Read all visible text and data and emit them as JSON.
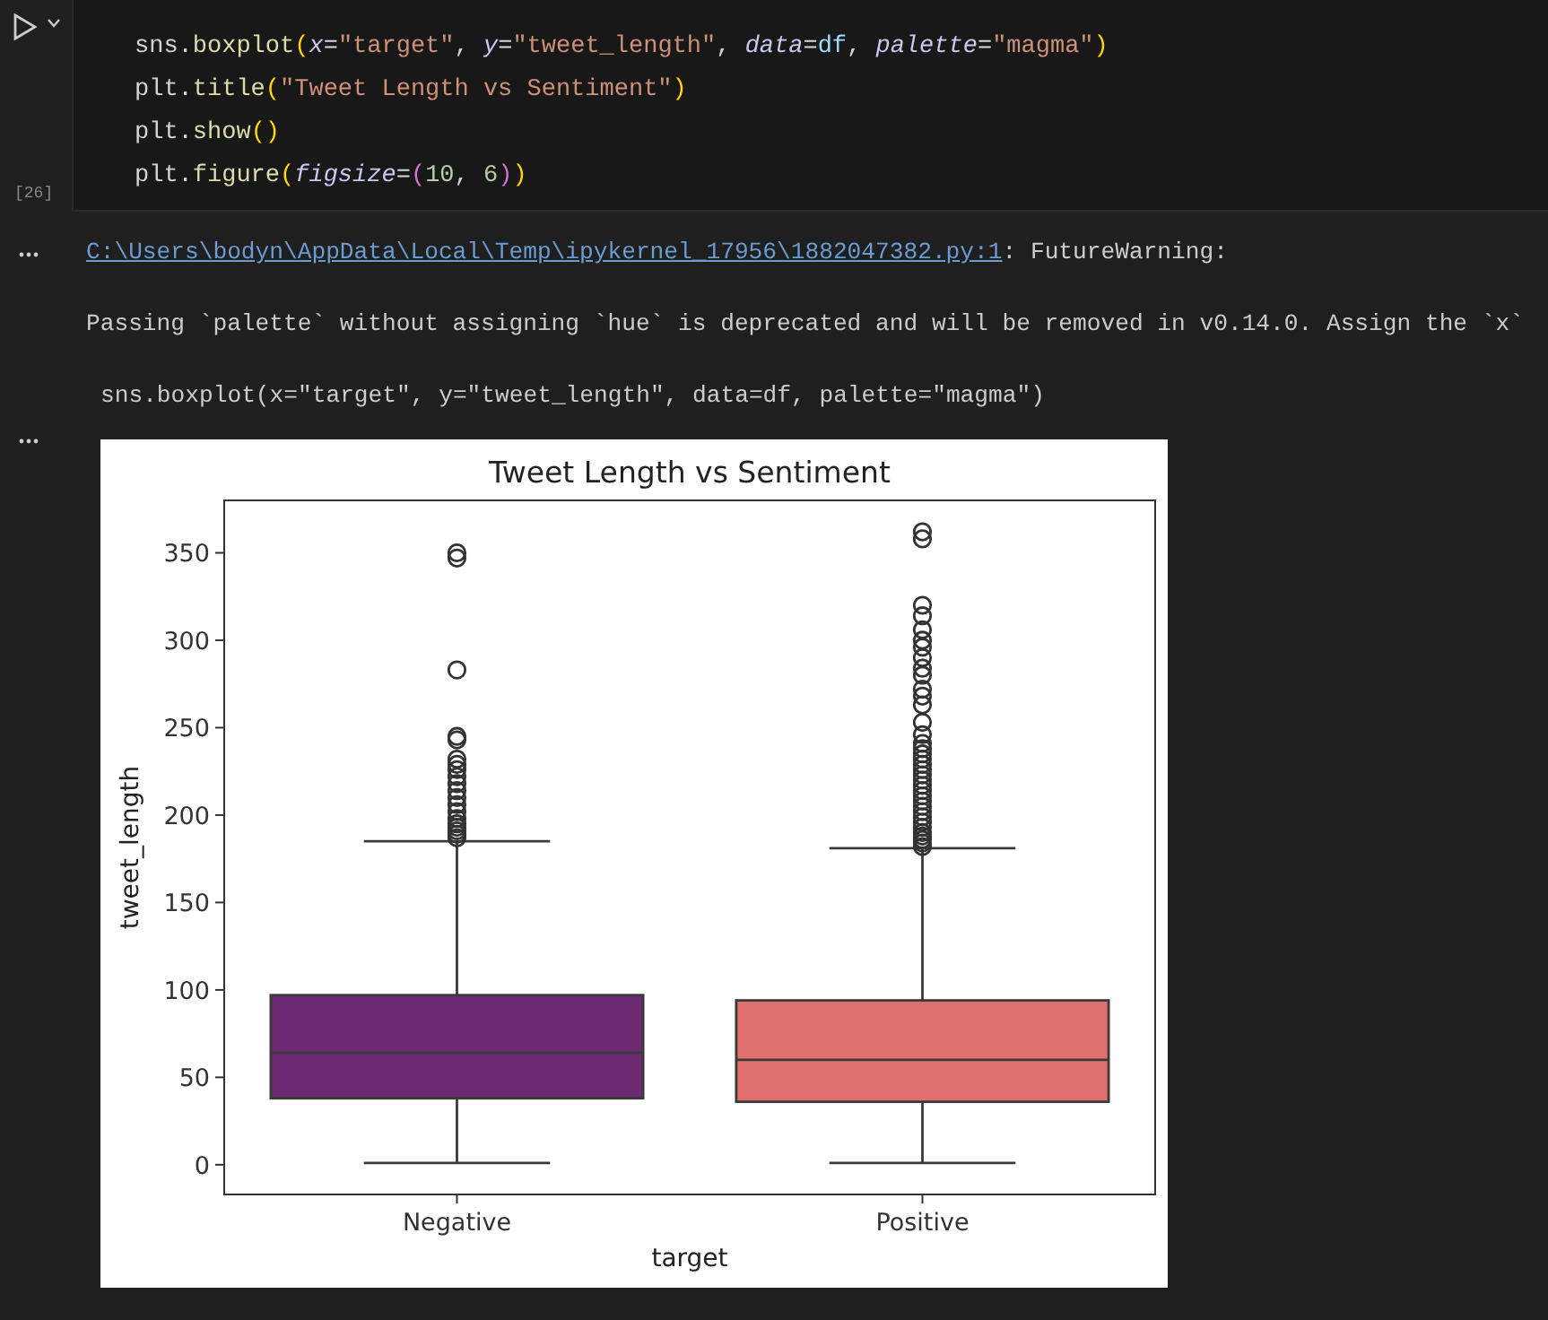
{
  "cell": {
    "execution_count": "[26]",
    "code_lines": [
      [
        {
          "kind": "plain",
          "text": "sns."
        },
        {
          "kind": "func",
          "text": "boxplot"
        },
        {
          "kind": "bracket",
          "text": "("
        },
        {
          "kind": "param",
          "text": "x"
        },
        {
          "kind": "plain",
          "text": "="
        },
        {
          "kind": "string",
          "text": "\"target\""
        },
        {
          "kind": "plain",
          "text": ", "
        },
        {
          "kind": "param",
          "text": "y"
        },
        {
          "kind": "plain",
          "text": "="
        },
        {
          "kind": "string",
          "text": "\"tweet_length\""
        },
        {
          "kind": "plain",
          "text": ", "
        },
        {
          "kind": "param",
          "text": "data"
        },
        {
          "kind": "plain",
          "text": "="
        },
        {
          "kind": "var",
          "text": "df"
        },
        {
          "kind": "plain",
          "text": ", "
        },
        {
          "kind": "param",
          "text": "palette"
        },
        {
          "kind": "plain",
          "text": "="
        },
        {
          "kind": "string",
          "text": "\"magma\""
        },
        {
          "kind": "bracket",
          "text": ")"
        }
      ],
      [
        {
          "kind": "plain",
          "text": "plt."
        },
        {
          "kind": "func",
          "text": "title"
        },
        {
          "kind": "bracket",
          "text": "("
        },
        {
          "kind": "string",
          "text": "\"Tweet Length vs Sentiment\""
        },
        {
          "kind": "bracket",
          "text": ")"
        }
      ],
      [
        {
          "kind": "plain",
          "text": "plt."
        },
        {
          "kind": "func",
          "text": "show"
        },
        {
          "kind": "bracket",
          "text": "()"
        }
      ],
      [
        {
          "kind": "plain",
          "text": "plt."
        },
        {
          "kind": "func",
          "text": "figure"
        },
        {
          "kind": "bracket",
          "text": "("
        },
        {
          "kind": "param",
          "text": "figsize"
        },
        {
          "kind": "plain",
          "text": "="
        },
        {
          "kind": "bracket2",
          "text": "("
        },
        {
          "kind": "number",
          "text": "10"
        },
        {
          "kind": "plain",
          "text": ", "
        },
        {
          "kind": "number",
          "text": "6"
        },
        {
          "kind": "bracket2",
          "text": ")"
        },
        {
          "kind": "bracket",
          "text": ")"
        }
      ]
    ]
  },
  "warning_output": {
    "link": "C:\\Users\\bodyn\\AppData\\Local\\Temp\\ipykernel_17956\\1882047382.py:1",
    "category": ": FutureWarning:",
    "message": "Passing `palette` without assigning `hue` is deprecated and will be removed in v0.14.0. Assign the `x`",
    "source_line": "sns.boxplot(x=\"target\", y=\"tweet_length\", data=df, palette=\"magma\")"
  },
  "plot_output": {
    "title": "Tweet Length vs Sentiment",
    "xlabel": "target",
    "ylabel": "tweet_length",
    "ytick_labels": [
      "350",
      "300",
      "250",
      "200",
      "150",
      "100",
      "50",
      "0"
    ],
    "categories": [
      {
        "label": "Negative",
        "color": "#6b2a72"
      },
      {
        "label": "Positive",
        "color": "#e0706d"
      }
    ]
  }
}
